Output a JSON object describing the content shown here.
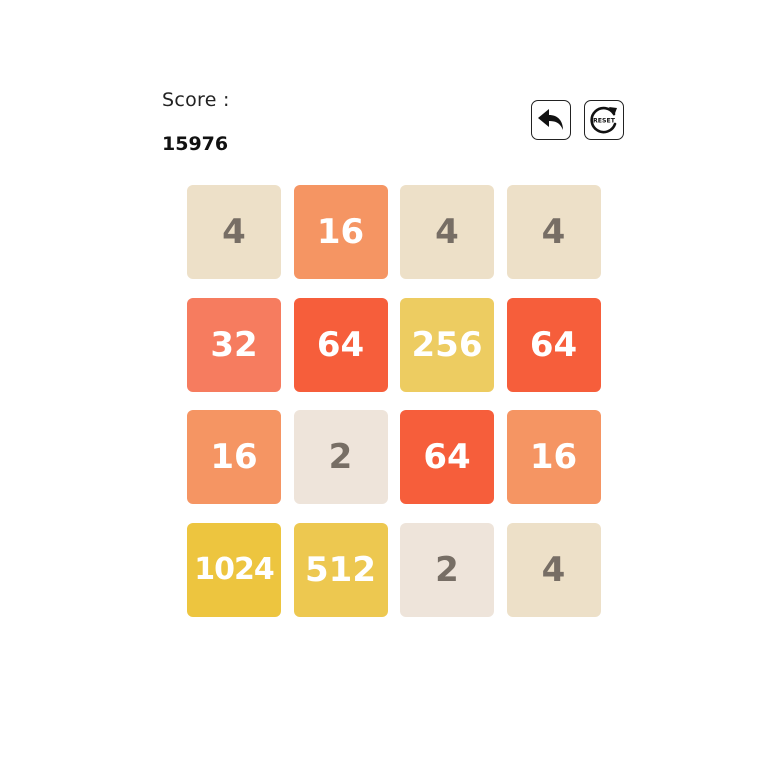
{
  "score": {
    "label": "Score :",
    "value": "15976"
  },
  "controls": {
    "undo_icon": "undo-arrow-icon",
    "reset_icon": "reset-circular-arrow-icon",
    "reset_text": "RESET"
  },
  "board": {
    "rows": [
      [
        "4",
        "16",
        "4",
        "4"
      ],
      [
        "32",
        "64",
        "256",
        "64"
      ],
      [
        "16",
        "2",
        "64",
        "16"
      ],
      [
        "1024",
        "512",
        "2",
        "4"
      ]
    ]
  },
  "colors": {
    "tile_2": "#eee4da",
    "tile_4": "#ede0c8",
    "tile_16": "#f59563",
    "tile_32": "#f67c5f",
    "tile_64": "#f65e3b",
    "tile_256": "#edcc61",
    "tile_512": "#edc850",
    "tile_1024": "#edc53f",
    "dark_text": "#776e65"
  }
}
